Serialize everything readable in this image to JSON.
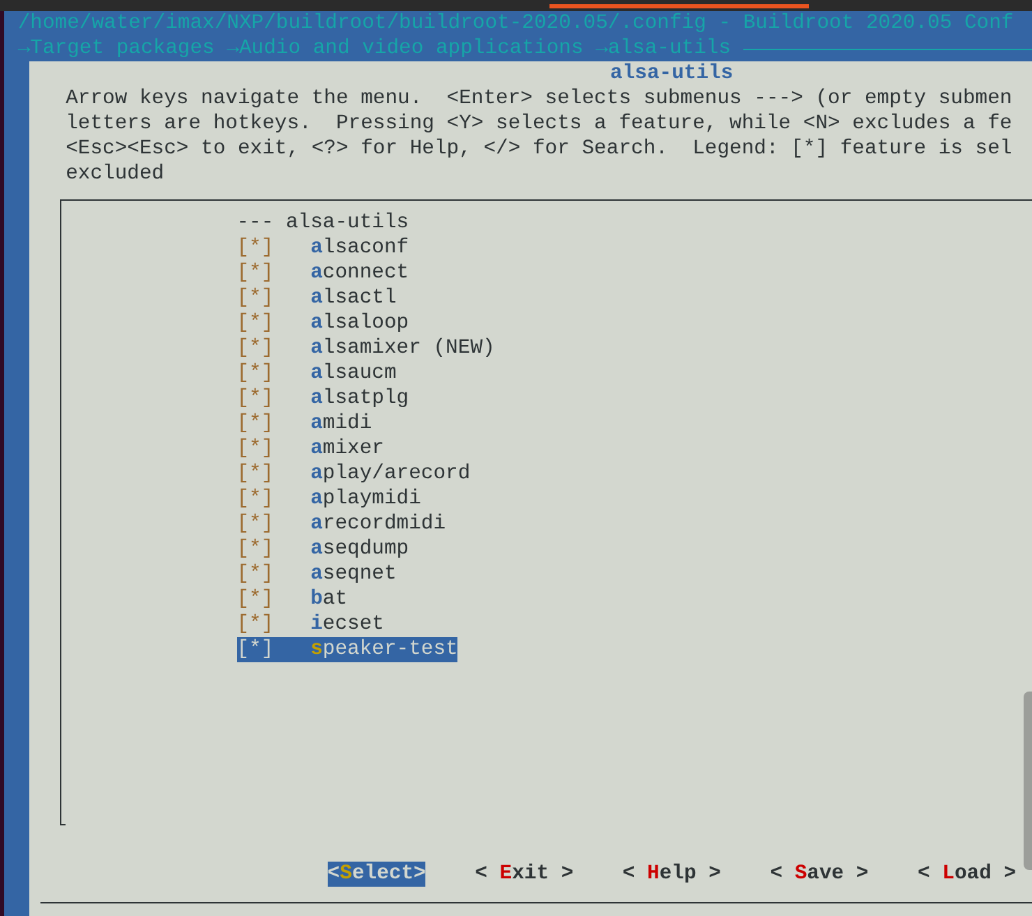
{
  "window": {
    "title": "/home/water/imax/NXP/buildroot/buildroot-2020.05/.config - Buildroot 2020.05 Conf"
  },
  "breadcrumb": [
    {
      "label": "→Target packages"
    },
    {
      "label": "→Audio and video applications"
    },
    {
      "label": "→alsa-utils"
    }
  ],
  "dialog": {
    "title": "alsa-utils",
    "help_lines": [
      "Arrow keys navigate the menu.  <Enter> selects submenus ---> (or empty submen",
      "letters are hotkeys.  Pressing <Y> selects a feature, while <N> excludes a fe",
      "<Esc><Esc> to exit, <?> for Help, </> for Search.  Legend: [*] feature is sel",
      "excluded"
    ],
    "menu": {
      "heading": "--- alsa-utils",
      "items": [
        {
          "box": "[*]",
          "label": "alsaconf",
          "selected": false
        },
        {
          "box": "[*]",
          "label": "aconnect",
          "selected": false
        },
        {
          "box": "[*]",
          "label": "alsactl",
          "selected": false
        },
        {
          "box": "[*]",
          "label": "alsaloop",
          "selected": false
        },
        {
          "box": "[*]",
          "label": "alsamixer (NEW)",
          "selected": false
        },
        {
          "box": "[*]",
          "label": "alsaucm",
          "selected": false
        },
        {
          "box": "[*]",
          "label": "alsatplg",
          "selected": false
        },
        {
          "box": "[*]",
          "label": "amidi",
          "selected": false
        },
        {
          "box": "[*]",
          "label": "amixer",
          "selected": false
        },
        {
          "box": "[*]",
          "label": "aplay/arecord",
          "selected": false
        },
        {
          "box": "[*]",
          "label": "aplaymidi",
          "selected": false
        },
        {
          "box": "[*]",
          "label": "arecordmidi",
          "selected": false
        },
        {
          "box": "[*]",
          "label": "aseqdump",
          "selected": false
        },
        {
          "box": "[*]",
          "label": "aseqnet",
          "selected": false
        },
        {
          "box": "[*]",
          "label": "bat",
          "selected": false
        },
        {
          "box": "[*]",
          "label": "iecset",
          "selected": false
        },
        {
          "box": "[*]",
          "label": "speaker-test",
          "selected": true
        }
      ]
    },
    "buttons": [
      {
        "label": "<Select>",
        "selected": true
      },
      {
        "label": "< Exit >",
        "selected": false
      },
      {
        "label": "< Help >",
        "selected": false
      },
      {
        "label": "< Save >",
        "selected": false
      },
      {
        "label": "< Load >",
        "selected": false
      }
    ]
  }
}
